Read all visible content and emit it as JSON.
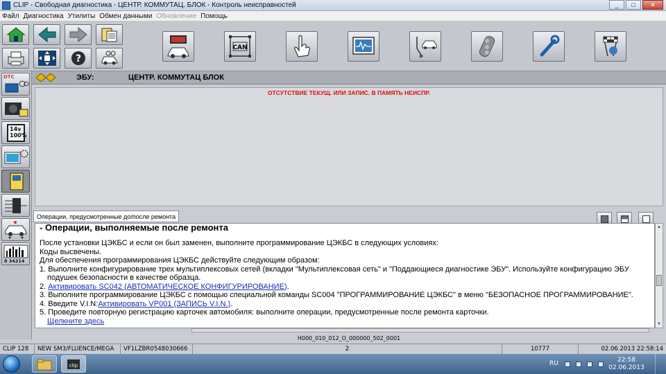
{
  "window": {
    "title": "CLIP - Свободная диагностика - ЦЕНТР. КОММУТАЦ. БЛОК - Контроль неисправностей"
  },
  "menu": [
    {
      "label": "Файл",
      "enabled": true
    },
    {
      "label": "Диагностика",
      "enabled": true
    },
    {
      "label": "Утилиты",
      "enabled": true
    },
    {
      "label": "Обмен данными",
      "enabled": true
    },
    {
      "label": "Обновление",
      "enabled": false
    },
    {
      "label": "Помощь",
      "enabled": true
    }
  ],
  "toolbar": {
    "can_label": "CAN"
  },
  "sidebar": {
    "dtc_label": "DTC",
    "battery_label": "14v\n100%",
    "counter_label": "8 34214"
  },
  "ecu": {
    "label": "ЭБУ:",
    "name": "ЦЕНТР. КОММУТАЦ БЛОК"
  },
  "fault_panel": {
    "message": "ОТСУТСТВИЕ ТЕКУЩ. ИЛИ ЗАПИС. В ПАМЯТЬ НЕИСПР."
  },
  "ops_tab": {
    "label": "Операции, предусмотренные до/после ремонта"
  },
  "doc": {
    "heading": "- Операции, выполняемые после ремонта",
    "p1": "После установки ЦЭКБС и если он был заменен, выполните программирование ЦЭКБС в следующих условиях:",
    "p2": "Коды высвечены.",
    "p3": "Для обеспечения программирования ЦЭКБС действуйте следующим образом:",
    "item1": "1. Выполните конфигурирование трех мультиплексовых сетей (вкладки \"Мультиплексовая сеть\" и \"Поддающиеся диагностике ЭБУ\". Используйте конфигурацию ЭБУ",
    "item1b": "подушек безопасности в качестве образца.",
    "item2_prefix": "2. ",
    "item2_link": "Активировать SC042 (АВТОМАТИЧЕСКОЕ КОНФИГУРИРОВАНИЕ)",
    "item2_suffix": ".",
    "item3": "3. Выполните программирование ЦЭКБС с помощью специальной команды SC004 \"ПРОГРАММИРОВАНИЕ ЦЭКБС\" в меню \"БЕЗОПАСНОЕ ПРОГРАММИРОВАНИЕ\".",
    "item4_prefix": "4. Введите V.I.N:",
    "item4_link": "Активировать VP001 (ЗАПИСЬ V.I.N.)",
    "item4_suffix": ".",
    "item5": "5. Проведите повторную регистрацию карточек автомобиля: выполните операции, предусмотренные после ремонта карточки.",
    "click_here": "Щелкните здесь"
  },
  "footer_code": "H000_010_012_O_000000_502_0001",
  "status": [
    "CLIP 128",
    "NEW SM3/FLUENCE/MEGA",
    "VF1LZBR0548030666",
    "2",
    "10777",
    "02.06.2013 22:58:14"
  ],
  "taskbar": {
    "lang": "RU",
    "time": "22:58",
    "date": "02.06.2013"
  },
  "colors": {
    "fault_red": "#d3120e",
    "link_blue": "#1b2bb0"
  }
}
